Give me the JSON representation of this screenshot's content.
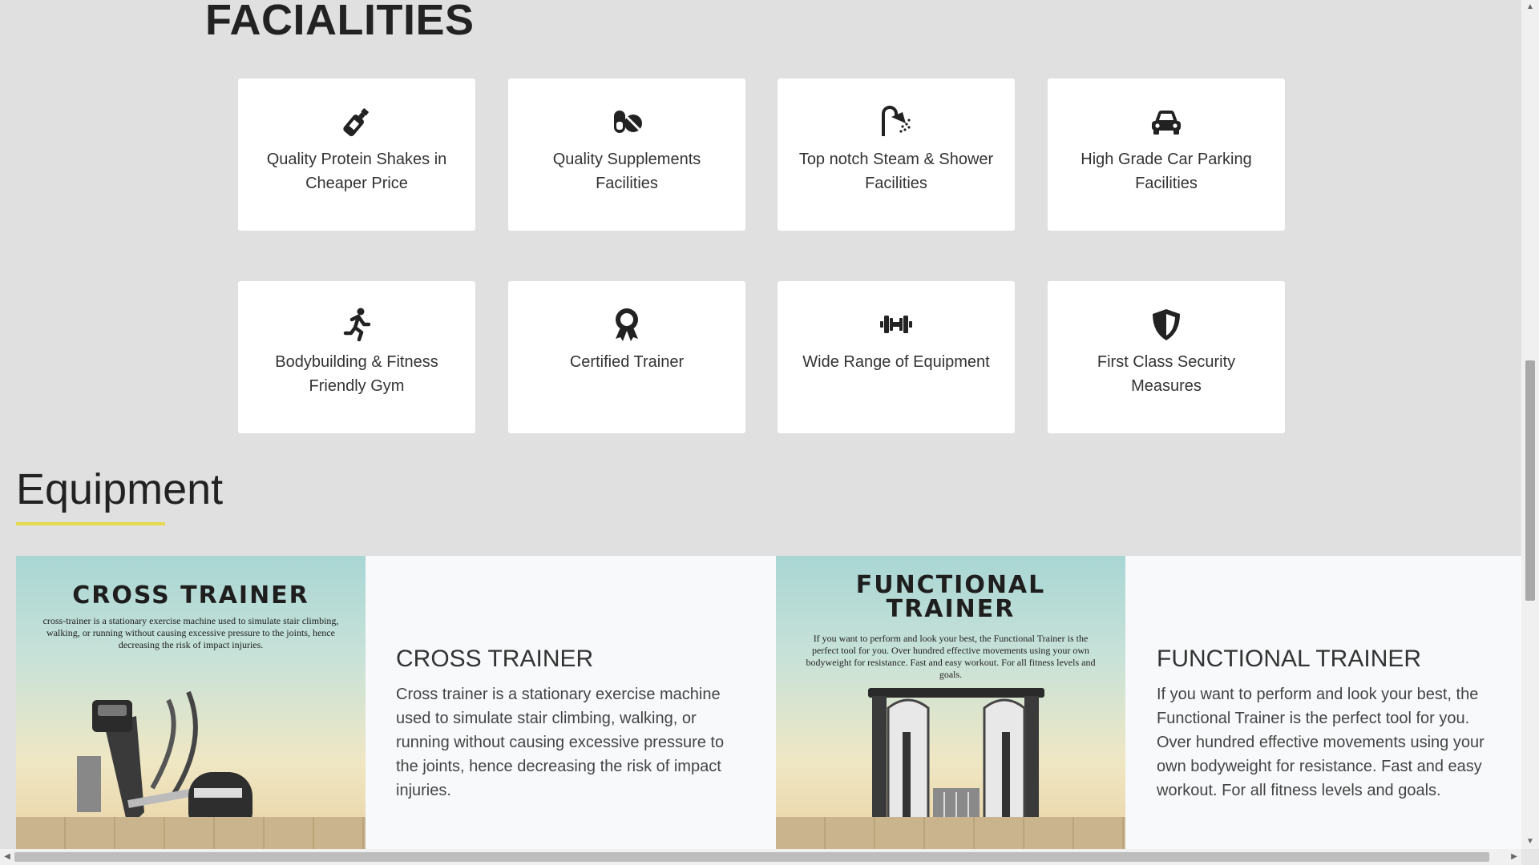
{
  "facilities": {
    "title": "FACIALITIES",
    "cards": [
      {
        "icon": "wine-bottle-icon",
        "text": "Quality Protein Shakes in Cheaper Price"
      },
      {
        "icon": "pills-icon",
        "text": "Quality Supplements Facilities"
      },
      {
        "icon": "shower-icon",
        "text": "Top notch Steam & Shower Facilities"
      },
      {
        "icon": "car-icon",
        "text": "High Grade Car Parking Facilities"
      },
      {
        "icon": "running-icon",
        "text": "Bodybuilding & Fitness Friendly Gym"
      },
      {
        "icon": "award-icon",
        "text": "Certified Trainer"
      },
      {
        "icon": "dumbbell-icon",
        "text": "Wide Range of Equipment"
      },
      {
        "icon": "shield-icon",
        "text": "First Class Security Measures"
      }
    ]
  },
  "equipment": {
    "title": "Equipment",
    "accent_color": "#e6d94a",
    "items": [
      {
        "poster_title": "CROSS TRAINER",
        "poster_desc": "cross-trainer is a stationary exercise machine used to simulate stair climbing, walking, or running without causing excessive pressure to the joints, hence decreasing the risk of impact injuries.",
        "heading": "CROSS TRAINER",
        "desc": "Cross trainer is a stationary exercise machine used to simulate stair climbing, walking, or running without causing excessive pressure to the joints, hence decreasing the risk of impact injuries."
      },
      {
        "poster_title_line1": "FUNCTIONAL",
        "poster_title_line2": "TRAINER",
        "poster_desc": "If you want to perform and look your best, the Functional Trainer is the perfect tool for you. Over hundred effective movements using your own bodyweight for resistance. Fast and easy workout. For all fitness levels and goals.",
        "heading": "FUNCTIONAL TRAINER",
        "desc": "If you want to perform and look your best, the Functional Trainer is the perfect tool for you. Over hundred effective movements using your own bodyweight for resistance. Fast and easy workout. For all fitness levels and goals."
      }
    ]
  }
}
